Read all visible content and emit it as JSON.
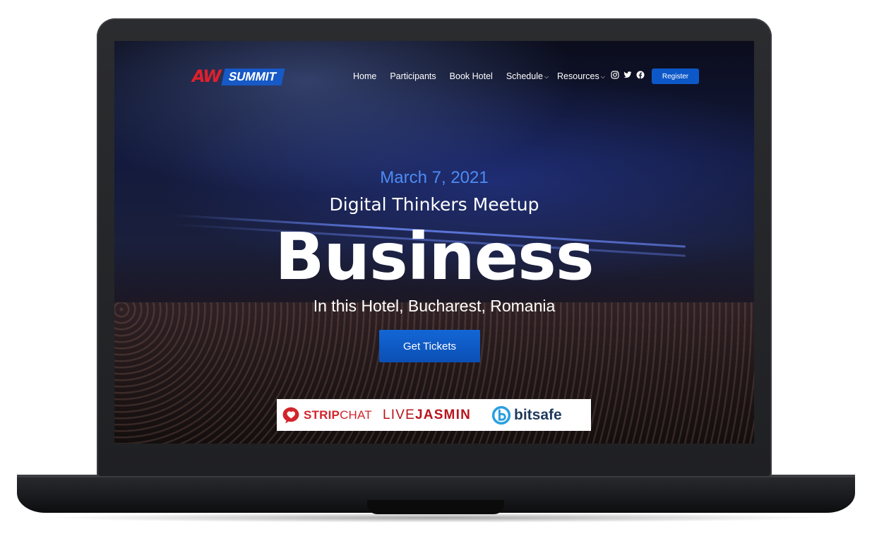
{
  "logo": {
    "mark": "AW",
    "word": "SUMMIT"
  },
  "nav": {
    "items": [
      {
        "label": "Home",
        "dropdown": false
      },
      {
        "label": "Participants",
        "dropdown": false
      },
      {
        "label": "Book Hotel",
        "dropdown": false
      },
      {
        "label": "Schedule",
        "dropdown": true
      },
      {
        "label": "Resources",
        "dropdown": true
      }
    ],
    "socials": [
      "instagram-icon",
      "twitter-icon",
      "facebook-icon"
    ],
    "register_label": "Register"
  },
  "hero": {
    "date": "March 7, 2021",
    "subtitle": "Digital Thinkers Meetup",
    "title": "Business",
    "location": "In this Hotel, Bucharest, Romania",
    "cta_label": "Get Tickets"
  },
  "sponsors": {
    "stripchat": {
      "strong": "STRIP",
      "rest": "CHAT"
    },
    "livejasmin": {
      "live": "LIVE",
      "jasmin": "JASMIN"
    },
    "bitsafe": "bitsafe"
  },
  "colors": {
    "accent": "#0d58c9",
    "date_text": "#4d8cf4",
    "logo_red": "#e0202b",
    "stripchat_red": "#d2242c"
  }
}
